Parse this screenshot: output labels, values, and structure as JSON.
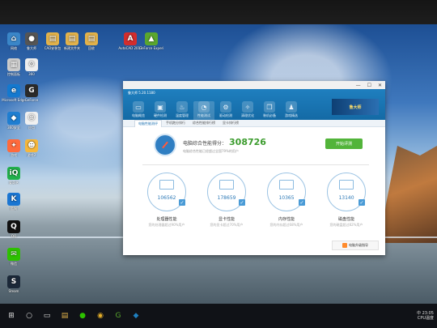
{
  "desktop": {
    "icons": [
      {
        "label": "网络",
        "color": "#3a86c8",
        "glyph": "⌂"
      },
      {
        "label": "鲁大师",
        "color": "#555",
        "glyph": "●"
      },
      {
        "label": "CAD安装包",
        "color": "#e2b24b",
        "glyph": "▤"
      },
      {
        "label": "新建文件夹",
        "color": "#e2b24b",
        "glyph": "▤"
      },
      {
        "label": "回收",
        "color": "#e2b24b",
        "glyph": "▤"
      },
      {
        "label": "AutoCAD 2017",
        "color": "#d22d2d",
        "glyph": "A"
      },
      {
        "label": "GeForce Experience",
        "color": "#5aa72e",
        "glyph": "▲"
      },
      {
        "label": "控制面板",
        "color": "#ccc",
        "glyph": "▦"
      },
      {
        "label": "360",
        "color": "#eee",
        "glyph": "⚙"
      },
      {
        "label": "Microsoft Edge",
        "color": "#1479cf",
        "glyph": "e"
      },
      {
        "label": "GeForce",
        "color": "#2a2a2a",
        "glyph": "G"
      },
      {
        "label": "360安全",
        "color": "#1f7ed1",
        "glyph": "◆"
      },
      {
        "label": "应用",
        "color": "#f0f0f0",
        "glyph": "☺"
      },
      {
        "label": "游戏",
        "color": "#ff6a3c",
        "glyph": "✦"
      },
      {
        "label": "游戏2",
        "color": "#f6b73c",
        "glyph": "☻"
      },
      {
        "label": "爱奇艺",
        "color": "#22b14c",
        "glyph": "iQ"
      },
      {
        "label": "酷狗",
        "color": "#1b76d2",
        "glyph": "K"
      },
      {
        "label": "QQ",
        "color": "#111",
        "glyph": "Q"
      },
      {
        "label": "微信",
        "color": "#2dc100",
        "glyph": "✉"
      },
      {
        "label": "Steam",
        "color": "#1b2838",
        "glyph": "S"
      }
    ]
  },
  "window": {
    "app_title": "鲁大师 5.20.1180",
    "tabs": [
      {
        "label": "电脑概览",
        "icon": "monitor-icon"
      },
      {
        "label": "硬件检测",
        "icon": "chip-icon"
      },
      {
        "label": "温度管理",
        "icon": "thermometer-icon"
      },
      {
        "label": "性能测试",
        "icon": "speedometer-icon"
      },
      {
        "label": "驱动检测",
        "icon": "driver-icon"
      },
      {
        "label": "清理优化",
        "icon": "broom-icon"
      },
      {
        "label": "装机必备",
        "icon": "cube-icon"
      },
      {
        "label": "游戏精选",
        "icon": "gamepad-icon"
      }
    ],
    "active_tab": 3,
    "banner_text": "鲁大师",
    "subtabs": [
      "电脑性能测评",
      "手机跑分排行",
      "综合性能排行榜",
      "显卡排行榜"
    ],
    "active_subtab": 0,
    "score_label": "电脑综合性能得分：",
    "score_value": "308726",
    "score_desc": "电脑综合性能已经超过全国79%的用户",
    "start_button": "开始评测",
    "metrics": [
      {
        "value": "106562",
        "name": "处理器性能",
        "desc": "您的处理器超过90%用户"
      },
      {
        "value": "178659",
        "name": "显卡性能",
        "desc": "您的显卡超过70%用户"
      },
      {
        "value": "10365",
        "name": "内存性能",
        "desc": "您的内存超过68%用户"
      },
      {
        "value": "13140",
        "name": "磁盘性能",
        "desc": "您的磁盘超过82%用户"
      }
    ],
    "help_text": "电脑升级指导"
  },
  "taskbar": {
    "clock_time": "23:05",
    "clock_label": "CPU温度",
    "lang": "中"
  }
}
